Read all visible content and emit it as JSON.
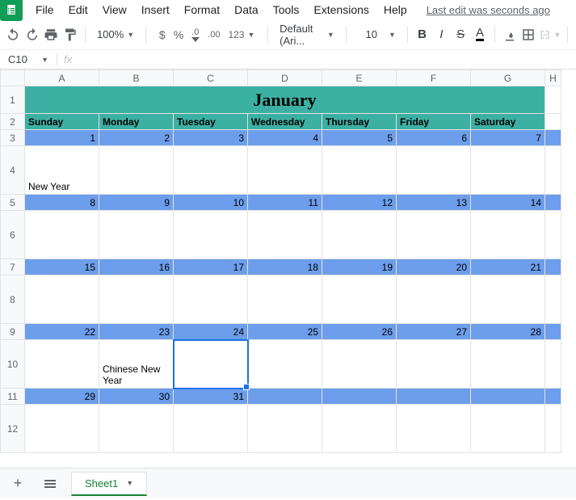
{
  "menu": {
    "file": "File",
    "edit": "Edit",
    "view": "View",
    "insert": "Insert",
    "format": "Format",
    "data": "Data",
    "tools": "Tools",
    "extensions": "Extensions",
    "help": "Help"
  },
  "last_edit": "Last edit was seconds ago",
  "toolbar": {
    "zoom": "100%",
    "currency": "$",
    "percent": "%",
    "dec_dec": ".0",
    "dec_inc": ".00",
    "fmt123": "123",
    "font": "Default (Ari...",
    "size": "10"
  },
  "namebox": "C10",
  "columns": [
    "A",
    "B",
    "C",
    "D",
    "E",
    "F",
    "G",
    "H"
  ],
  "rows": [
    "1",
    "2",
    "3",
    "4",
    "5",
    "6",
    "7",
    "8",
    "9",
    "10",
    "11",
    "12"
  ],
  "calendar": {
    "month": "January",
    "weekdays": [
      "Sunday",
      "Monday",
      "Tuesday",
      "Wednesday",
      "Thursday",
      "Friday",
      "Saturday"
    ],
    "weeks": [
      {
        "nums": [
          "1",
          "2",
          "3",
          "4",
          "5",
          "6",
          "7"
        ],
        "events": [
          "New Year",
          "",
          "",
          "",
          "",
          "",
          ""
        ]
      },
      {
        "nums": [
          "8",
          "9",
          "10",
          "11",
          "12",
          "13",
          "14"
        ],
        "events": [
          "",
          "",
          "",
          "",
          "",
          "",
          ""
        ]
      },
      {
        "nums": [
          "15",
          "16",
          "17",
          "18",
          "19",
          "20",
          "21"
        ],
        "events": [
          "",
          "",
          "",
          "",
          "",
          "",
          ""
        ]
      },
      {
        "nums": [
          "22",
          "23",
          "24",
          "25",
          "26",
          "27",
          "28"
        ],
        "events": [
          "",
          "Chinese New Year",
          "",
          "",
          "",
          "",
          ""
        ]
      },
      {
        "nums": [
          "29",
          "30",
          "31",
          "",
          "",
          "",
          ""
        ],
        "events": [
          "",
          "",
          "",
          "",
          "",
          "",
          ""
        ]
      }
    ]
  },
  "sheet_tab": "Sheet1",
  "colors": {
    "month_bg": "#3cb0a3",
    "daynum_bg": "#6d9eeb",
    "title_fg": "#c00000",
    "event_fg": "#cc0000",
    "selection": "#1a73e8"
  }
}
